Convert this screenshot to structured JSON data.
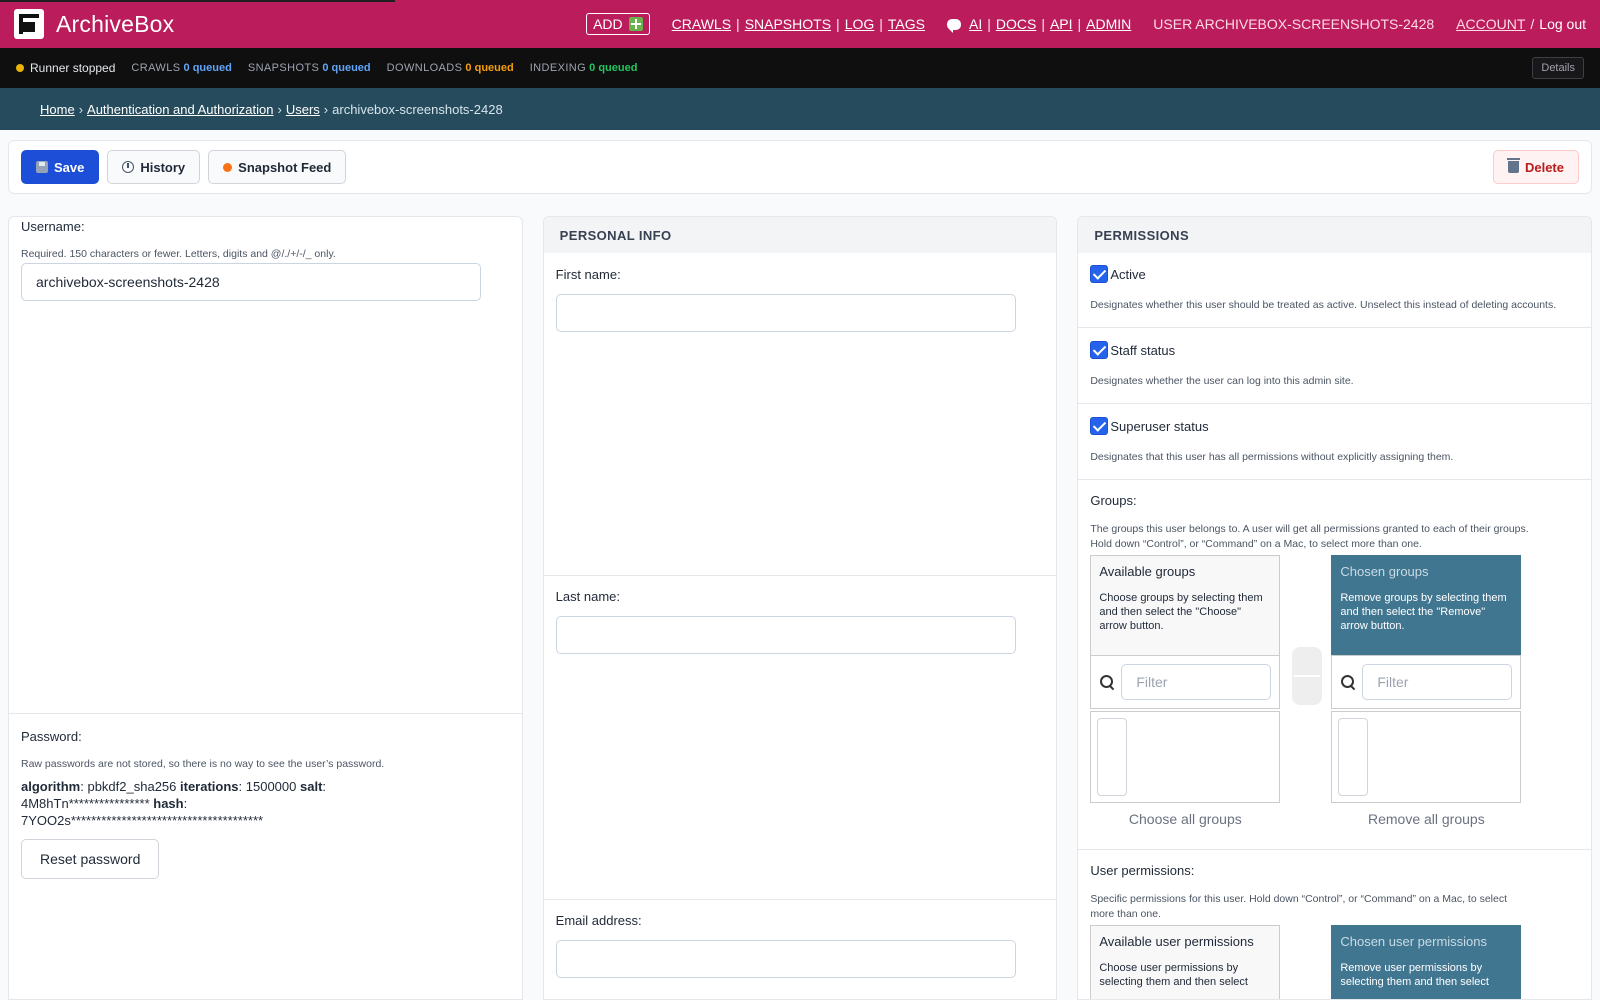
{
  "header": {
    "brand": "ArchiveBox",
    "add_label": "ADD",
    "nav1": [
      "CRAWLS",
      "SNAPSHOTS",
      "LOG",
      "TAGS"
    ],
    "nav2": [
      "AI",
      "DOCS",
      "API",
      "ADMIN"
    ],
    "user_label": "USER ARCHIVEBOX-SCREENSHOTS-2428",
    "account_label": "ACCOUNT",
    "logout_label": "Log out",
    "sep_pipe": "|",
    "sep_slash": "/"
  },
  "status": {
    "runner": "Runner stopped",
    "crawls_label": "CRAWLS",
    "crawls_value": "0 queued",
    "snapshots_label": "SNAPSHOTS",
    "snapshots_value": "0 queued",
    "downloads_label": "DOWNLOADS",
    "downloads_value": "0 queued",
    "indexing_label": "INDEXING",
    "indexing_value": "0 queued",
    "details_label": "Details"
  },
  "breadcrumb": {
    "home": "Home",
    "auth": "Authentication and Authorization",
    "users": "Users",
    "current": "archivebox-screenshots-2428",
    "sep": "›"
  },
  "actions": {
    "save": "Save",
    "history": "History",
    "feed": "Snapshot Feed",
    "delete": "Delete"
  },
  "username": {
    "label": "Username:",
    "help": "Required. 150 characters or fewer. Letters, digits and @/./+/-/_ only.",
    "value": "archivebox-screenshots-2428"
  },
  "password": {
    "label": "Password:",
    "help": "Raw passwords are not stored, so there is no way to see the user’s password.",
    "algorithm_key": "algorithm",
    "algorithm_val": "pbkdf2_sha256",
    "iterations_key": "iterations",
    "iterations_val": "1500000",
    "salt_key": "salt",
    "salt_val": "4M8hTn****************",
    "hash_key": "hash",
    "hash_val": "7YOO2s**************************************",
    "reset": "Reset password"
  },
  "personal": {
    "heading": "PERSONAL INFO",
    "first_name_label": "First name:",
    "first_name_value": "",
    "last_name_label": "Last name:",
    "last_name_value": "",
    "email_label": "Email address:",
    "email_value": ""
  },
  "permissions": {
    "heading": "PERMISSIONS",
    "active_label": "Active",
    "active_help": "Designates whether this user should be treated as active. Unselect this instead of deleting accounts.",
    "staff_label": "Staff status",
    "staff_help": "Designates whether the user can log into this admin site.",
    "superuser_label": "Superuser status",
    "superuser_help": "Designates that this user has all permissions without explicitly assigning them.",
    "groups_label": "Groups:",
    "groups_help": "The groups this user belongs to. A user will get all permissions granted to each of their groups. Hold down “Control”, or “Command” on a Mac, to select more than one.",
    "avail_groups_title": "Available groups",
    "avail_groups_desc": "Choose groups by selecting them and then select the \"Choose\" arrow button.",
    "chosen_groups_title": "Chosen groups",
    "chosen_groups_desc": "Remove groups by selecting them and then select the \"Remove\" arrow button.",
    "filter_placeholder": "Filter",
    "choose_all_groups": "Choose all groups",
    "remove_all_groups": "Remove all groups",
    "user_perms_label": "User permissions:",
    "user_perms_help": "Specific permissions for this user. Hold down “Control”, or “Command” on a Mac, to select more than one.",
    "avail_perms_title": "Available user permissions",
    "avail_perms_desc": "Choose user permissions by selecting them and then select",
    "chosen_perms_title": "Chosen user permissions",
    "chosen_perms_desc": "Remove user permissions by selecting them and then select"
  },
  "colors": {
    "header": "#ba1c5c",
    "statusbar": "#0f0f10",
    "breadcrumb": "#264b5d",
    "primary": "#1d4ed8",
    "chosen_box": "#417690"
  }
}
